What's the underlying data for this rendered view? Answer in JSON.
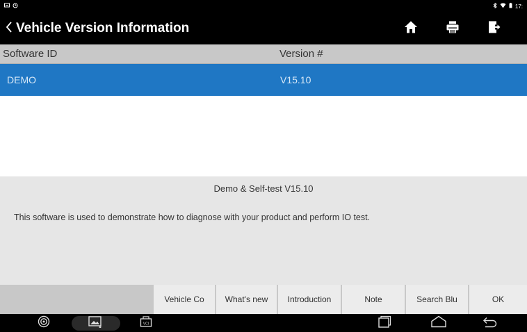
{
  "status_bar": {
    "time": "17:"
  },
  "header": {
    "title": "Vehicle Version Information"
  },
  "columns": {
    "software_id": "Software ID",
    "version": "Version #"
  },
  "rows": [
    {
      "software_id": "DEMO",
      "version": "V15.10"
    }
  ],
  "description": {
    "title": "Demo & Self-test V15.10",
    "text": "This software is used to demonstrate how to diagnose with your product and perform IO test."
  },
  "buttons": [
    {
      "label": "Vehicle Co"
    },
    {
      "label": "What's new"
    },
    {
      "label": "Introduction"
    },
    {
      "label": "Note"
    },
    {
      "label": "Search Blu"
    },
    {
      "label": "OK"
    }
  ],
  "nav": {
    "vci_label": "VCI"
  },
  "colors": {
    "selected_row": "#1f77c4",
    "header_bg": "#000000"
  }
}
